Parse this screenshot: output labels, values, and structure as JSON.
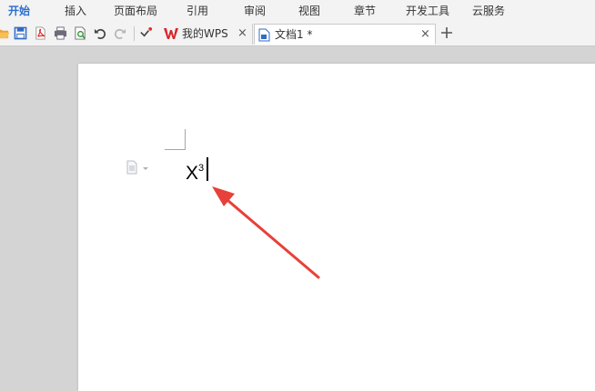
{
  "menubar": {
    "items": [
      {
        "label": "开始",
        "active": true
      },
      {
        "label": "插入",
        "active": false
      },
      {
        "label": "页面布局",
        "active": false
      },
      {
        "label": "引用",
        "active": false
      },
      {
        "label": "审阅",
        "active": false
      },
      {
        "label": "视图",
        "active": false
      },
      {
        "label": "章节",
        "active": false
      },
      {
        "label": "开发工具",
        "active": false
      },
      {
        "label": "云服务",
        "active": false
      }
    ]
  },
  "toolbar": {
    "icons": [
      "open-folder-icon",
      "save-icon",
      "export-pdf-icon",
      "print-icon",
      "print-preview-icon",
      "undo-icon",
      "redo-icon",
      "customize-toolbar-icon"
    ]
  },
  "tabs": [
    {
      "label": "我的WPS",
      "icon": "wps-logo-icon",
      "close": "×",
      "active": false
    },
    {
      "label": "文档1 *",
      "icon": "word-document-icon",
      "close": "×",
      "active": true
    }
  ],
  "new_tab": {
    "icon": "plus-icon"
  },
  "document": {
    "text": "X",
    "superscript": "3"
  },
  "annotation": {
    "color": "#e8403a"
  },
  "colors": {
    "accent": "#2a6fd1",
    "menubar_bg": "#f3f3f3",
    "workspace_bg": "#d4d4d4"
  }
}
